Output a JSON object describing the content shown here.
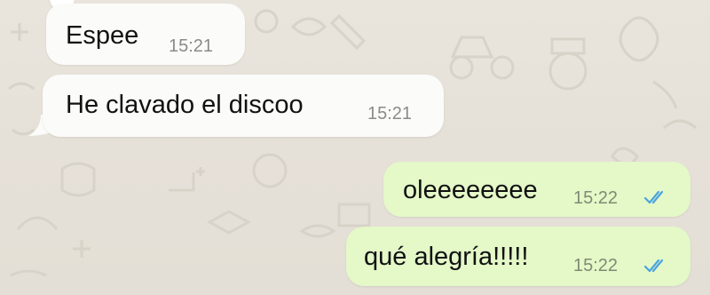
{
  "chat": {
    "messages": [
      {
        "direction": "incoming",
        "text": "Espee",
        "time": "15:21"
      },
      {
        "direction": "incoming",
        "text": "He clavado el discoo",
        "time": "15:21"
      },
      {
        "direction": "outgoing",
        "text": "oleeeeeeee",
        "time": "15:22",
        "status": "read"
      },
      {
        "direction": "outgoing",
        "text": "qué alegría!!!!!",
        "time": "15:22",
        "status": "read"
      }
    ]
  },
  "colors": {
    "wallpaper": "#e8e4dc",
    "incoming_bubble": "#fbfbfa",
    "outgoing_bubble": "#e4f8c8",
    "read_ticks": "#4aa4df"
  },
  "icons": {
    "ticks": "double-check-icon"
  }
}
